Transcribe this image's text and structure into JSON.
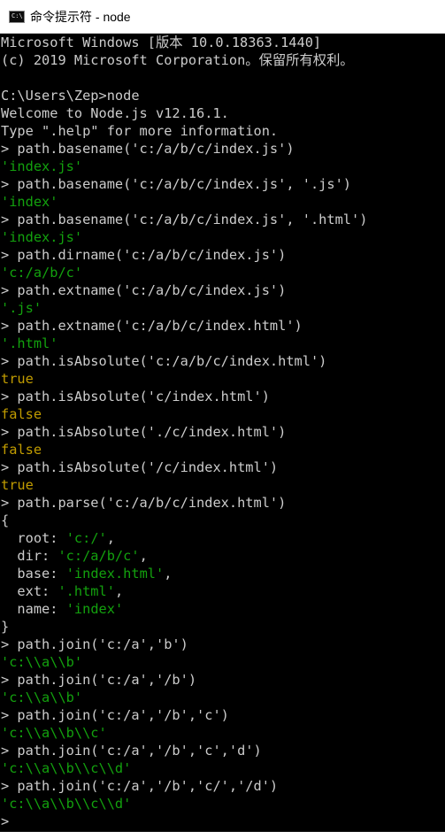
{
  "window": {
    "title": "命令提示符 - node",
    "icon": "cmd-icon",
    "icon_glyph": "C:\\"
  },
  "console": {
    "lines": [
      {
        "segments": [
          {
            "text": "Microsoft Windows [版本 10.0.18363.1440]",
            "color": "default"
          }
        ]
      },
      {
        "segments": [
          {
            "text": "(c) 2019 Microsoft Corporation。保留所有权利。",
            "color": "default"
          }
        ]
      },
      {
        "segments": [
          {
            "text": "",
            "color": "default"
          }
        ]
      },
      {
        "segments": [
          {
            "text": "C:\\Users\\Zep>node",
            "color": "default"
          }
        ]
      },
      {
        "segments": [
          {
            "text": "Welcome to Node.js v12.16.1.",
            "color": "default"
          }
        ]
      },
      {
        "segments": [
          {
            "text": "Type \".help\" for more information.",
            "color": "default"
          }
        ]
      },
      {
        "segments": [
          {
            "text": "> path.basename('c:/a/b/c/index.js')",
            "color": "default"
          }
        ]
      },
      {
        "segments": [
          {
            "text": "'index.js'",
            "color": "green"
          }
        ]
      },
      {
        "segments": [
          {
            "text": "> path.basename('c:/a/b/c/index.js', '.js')",
            "color": "default"
          }
        ]
      },
      {
        "segments": [
          {
            "text": "'index'",
            "color": "green"
          }
        ]
      },
      {
        "segments": [
          {
            "text": "> path.basename('c:/a/b/c/index.js', '.html')",
            "color": "default"
          }
        ]
      },
      {
        "segments": [
          {
            "text": "'index.js'",
            "color": "green"
          }
        ]
      },
      {
        "segments": [
          {
            "text": "> path.dirname('c:/a/b/c/index.js')",
            "color": "default"
          }
        ]
      },
      {
        "segments": [
          {
            "text": "'c:/a/b/c'",
            "color": "green"
          }
        ]
      },
      {
        "segments": [
          {
            "text": "> path.extname('c:/a/b/c/index.js')",
            "color": "default"
          }
        ]
      },
      {
        "segments": [
          {
            "text": "'.js'",
            "color": "green"
          }
        ]
      },
      {
        "segments": [
          {
            "text": "> path.extname('c:/a/b/c/index.html')",
            "color": "default"
          }
        ]
      },
      {
        "segments": [
          {
            "text": "'.html'",
            "color": "green"
          }
        ]
      },
      {
        "segments": [
          {
            "text": "> path.isAbsolute('c:/a/b/c/index.html')",
            "color": "default"
          }
        ]
      },
      {
        "segments": [
          {
            "text": "true",
            "color": "yellow"
          }
        ]
      },
      {
        "segments": [
          {
            "text": "> path.isAbsolute('c/index.html')",
            "color": "default"
          }
        ]
      },
      {
        "segments": [
          {
            "text": "false",
            "color": "yellow"
          }
        ]
      },
      {
        "segments": [
          {
            "text": "> path.isAbsolute('./c/index.html')",
            "color": "default"
          }
        ]
      },
      {
        "segments": [
          {
            "text": "false",
            "color": "yellow"
          }
        ]
      },
      {
        "segments": [
          {
            "text": "> path.isAbsolute('/c/index.html')",
            "color": "default"
          }
        ]
      },
      {
        "segments": [
          {
            "text": "true",
            "color": "yellow"
          }
        ]
      },
      {
        "segments": [
          {
            "text": "> path.parse('c:/a/b/c/index.html')",
            "color": "default"
          }
        ]
      },
      {
        "segments": [
          {
            "text": "{",
            "color": "default"
          }
        ]
      },
      {
        "segments": [
          {
            "text": "  root: ",
            "color": "default"
          },
          {
            "text": "'c:/'",
            "color": "green"
          },
          {
            "text": ",",
            "color": "default"
          }
        ]
      },
      {
        "segments": [
          {
            "text": "  dir: ",
            "color": "default"
          },
          {
            "text": "'c:/a/b/c'",
            "color": "green"
          },
          {
            "text": ",",
            "color": "default"
          }
        ]
      },
      {
        "segments": [
          {
            "text": "  base: ",
            "color": "default"
          },
          {
            "text": "'index.html'",
            "color": "green"
          },
          {
            "text": ",",
            "color": "default"
          }
        ]
      },
      {
        "segments": [
          {
            "text": "  ext: ",
            "color": "default"
          },
          {
            "text": "'.html'",
            "color": "green"
          },
          {
            "text": ",",
            "color": "default"
          }
        ]
      },
      {
        "segments": [
          {
            "text": "  name: ",
            "color": "default"
          },
          {
            "text": "'index'",
            "color": "green"
          }
        ]
      },
      {
        "segments": [
          {
            "text": "}",
            "color": "default"
          }
        ]
      },
      {
        "segments": [
          {
            "text": "> path.join('c:/a','b')",
            "color": "default"
          }
        ]
      },
      {
        "segments": [
          {
            "text": "'c:\\\\a\\\\b'",
            "color": "green"
          }
        ]
      },
      {
        "segments": [
          {
            "text": "> path.join('c:/a','/b')",
            "color": "default"
          }
        ]
      },
      {
        "segments": [
          {
            "text": "'c:\\\\a\\\\b'",
            "color": "green"
          }
        ]
      },
      {
        "segments": [
          {
            "text": "> path.join('c:/a','/b','c')",
            "color": "default"
          }
        ]
      },
      {
        "segments": [
          {
            "text": "'c:\\\\a\\\\b\\\\c'",
            "color": "green"
          }
        ]
      },
      {
        "segments": [
          {
            "text": "> path.join('c:/a','/b','c','d')",
            "color": "default"
          }
        ]
      },
      {
        "segments": [
          {
            "text": "'c:\\\\a\\\\b\\\\c\\\\d'",
            "color": "green"
          }
        ]
      },
      {
        "segments": [
          {
            "text": "> path.join('c:/a','/b','c/','/d')",
            "color": "default"
          }
        ]
      },
      {
        "segments": [
          {
            "text": "'c:\\\\a\\\\b\\\\c\\\\d'",
            "color": "green"
          }
        ]
      },
      {
        "segments": [
          {
            "text": ">",
            "color": "default"
          }
        ]
      }
    ]
  },
  "colors": {
    "background": "#000000",
    "default": "#cccccc",
    "green": "#13a10e",
    "yellow": "#c19c00",
    "titlebar": "#ffffff"
  }
}
